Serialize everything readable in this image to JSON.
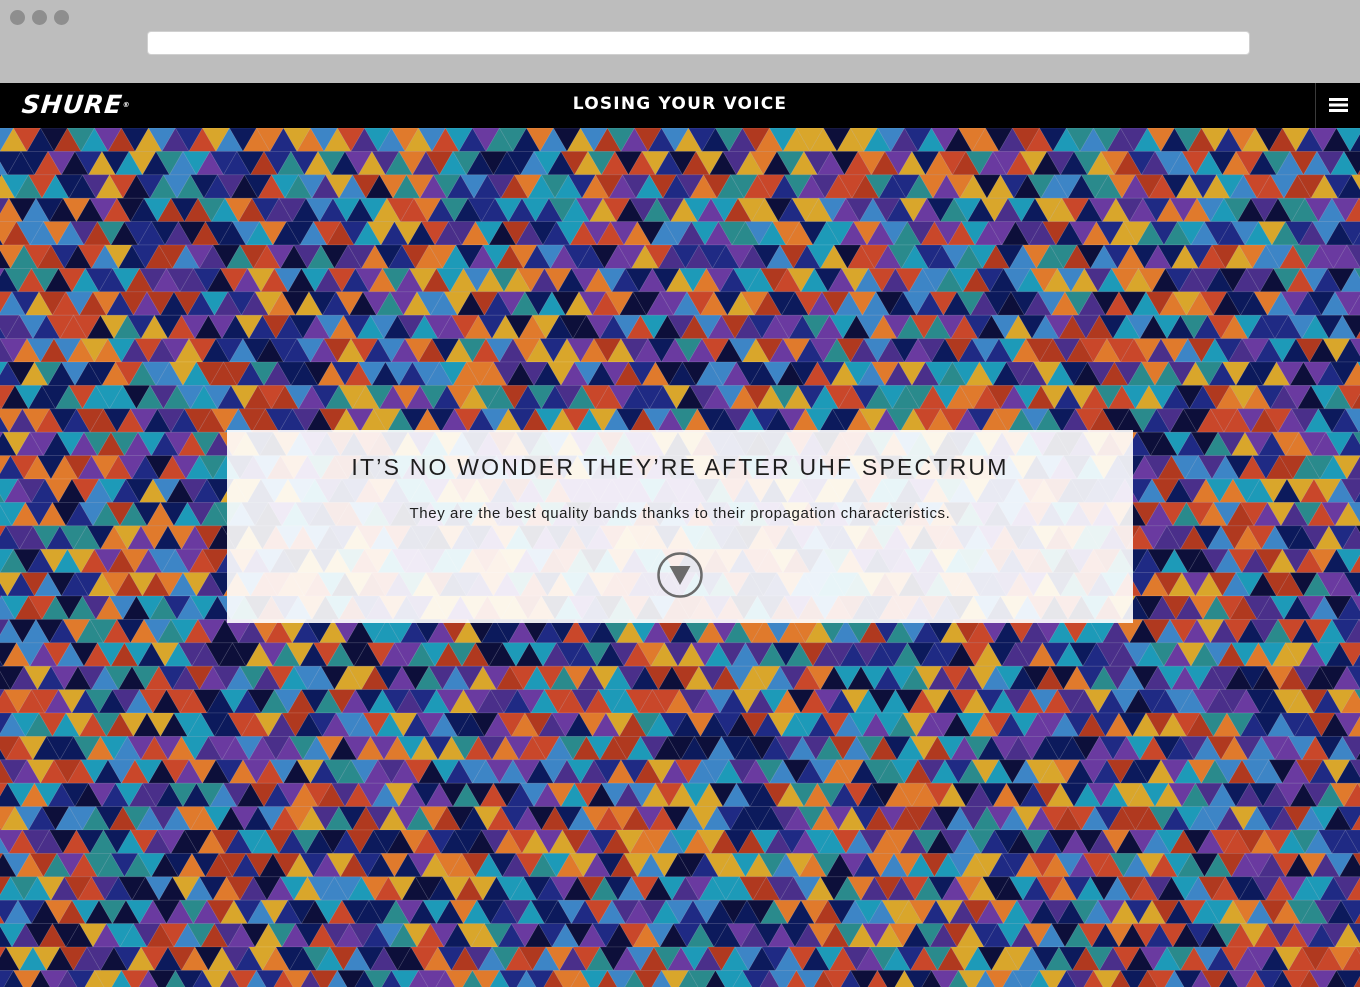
{
  "nav": {
    "logo_text": "SHURE",
    "logo_mark": "®",
    "title": "LOSING YOUR VOICE",
    "menu_icon": "hamburger-menu-icon"
  },
  "hero": {
    "headline": "IT’S NO WONDER THEY’RE AFTER UHF SPECTRUM",
    "subtext": "They are the best quality bands thanks to their propagation characteristics.",
    "scroll_icon": "down-arrow-circle-icon"
  },
  "colors": {
    "navbar": "#000000",
    "mosaic": [
      "#0c1a5c",
      "#1f2a84",
      "#3d85c6",
      "#1d9ab8",
      "#2a8a8c",
      "#d9a62b",
      "#c9472a",
      "#b0391f",
      "#4a2f8a",
      "#6a3aa0",
      "#0d0f3a",
      "#e07a2c"
    ]
  }
}
